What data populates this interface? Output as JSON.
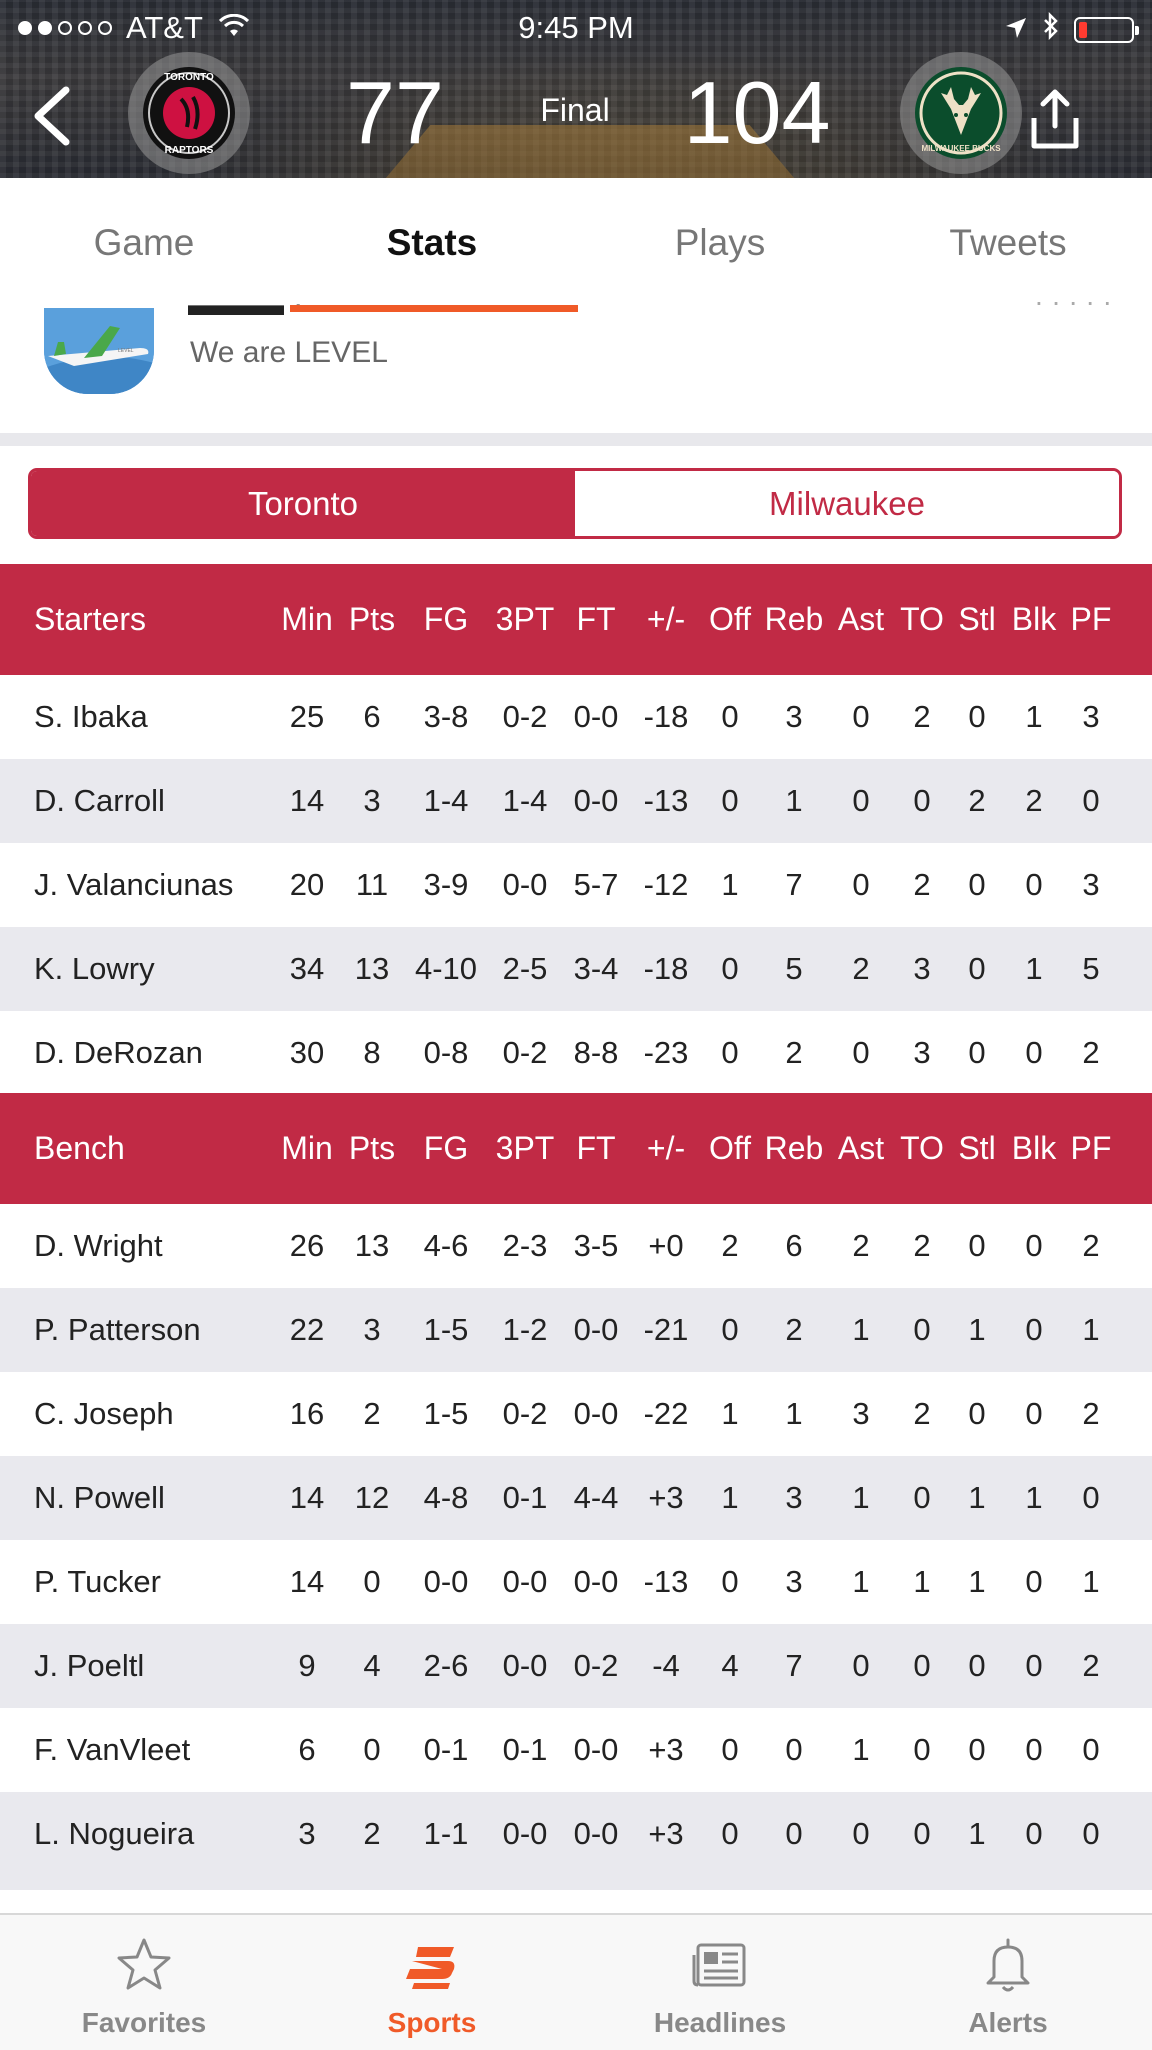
{
  "status_bar": {
    "carrier": "AT&T",
    "time": "9:45 PM",
    "signal_bars_filled": 2,
    "signal_bars_total": 5,
    "battery_level": "low"
  },
  "game_header": {
    "away_team": "Toronto Raptors",
    "away_logo_text": "TORONTO RAPTORS",
    "away_score": "77",
    "status": "Final",
    "home_team": "Milwaukee Bucks",
    "home_logo_text": "MILWAUKEE BUCKS",
    "home_score": "104"
  },
  "tabs": [
    {
      "label": "Game",
      "active": false
    },
    {
      "label": "Stats",
      "active": true
    },
    {
      "label": "Plays",
      "active": false
    },
    {
      "label": "Tweets",
      "active": false
    }
  ],
  "ad": {
    "text": "We are LEVEL",
    "image_caption": "LEVEL"
  },
  "team_selector": {
    "options": [
      "Toronto",
      "Milwaukee"
    ],
    "selected": "Toronto"
  },
  "columns": [
    "Min",
    "Pts",
    "FG",
    "3PT",
    "FT",
    "+/-",
    "Off",
    "Reb",
    "Ast",
    "TO",
    "Stl",
    "Blk",
    "PF"
  ],
  "starters": {
    "title": "Starters",
    "rows": [
      {
        "name": "S. Ibaka",
        "stats": [
          "25",
          "6",
          "3-8",
          "0-2",
          "0-0",
          "-18",
          "0",
          "3",
          "0",
          "2",
          "0",
          "1",
          "3"
        ]
      },
      {
        "name": "D. Carroll",
        "stats": [
          "14",
          "3",
          "1-4",
          "1-4",
          "0-0",
          "-13",
          "0",
          "1",
          "0",
          "0",
          "2",
          "2",
          "0"
        ]
      },
      {
        "name": "J. Valanciunas",
        "stats": [
          "20",
          "11",
          "3-9",
          "0-0",
          "5-7",
          "-12",
          "1",
          "7",
          "0",
          "2",
          "0",
          "0",
          "3"
        ]
      },
      {
        "name": "K. Lowry",
        "stats": [
          "34",
          "13",
          "4-10",
          "2-5",
          "3-4",
          "-18",
          "0",
          "5",
          "2",
          "3",
          "0",
          "1",
          "5"
        ]
      },
      {
        "name": "D. DeRozan",
        "stats": [
          "30",
          "8",
          "0-8",
          "0-2",
          "8-8",
          "-23",
          "0",
          "2",
          "0",
          "3",
          "0",
          "0",
          "2"
        ]
      }
    ]
  },
  "bench": {
    "title": "Bench",
    "rows": [
      {
        "name": "D. Wright",
        "stats": [
          "26",
          "13",
          "4-6",
          "2-3",
          "3-5",
          "+0",
          "2",
          "6",
          "2",
          "2",
          "0",
          "0",
          "2"
        ]
      },
      {
        "name": "P. Patterson",
        "stats": [
          "22",
          "3",
          "1-5",
          "1-2",
          "0-0",
          "-21",
          "0",
          "2",
          "1",
          "0",
          "1",
          "0",
          "1"
        ]
      },
      {
        "name": "C. Joseph",
        "stats": [
          "16",
          "2",
          "1-5",
          "0-2",
          "0-0",
          "-22",
          "1",
          "1",
          "3",
          "2",
          "0",
          "0",
          "2"
        ]
      },
      {
        "name": "N. Powell",
        "stats": [
          "14",
          "12",
          "4-8",
          "0-1",
          "4-4",
          "+3",
          "1",
          "3",
          "1",
          "0",
          "1",
          "1",
          "0"
        ]
      },
      {
        "name": "P. Tucker",
        "stats": [
          "14",
          "0",
          "0-0",
          "0-0",
          "0-0",
          "-13",
          "0",
          "3",
          "1",
          "1",
          "1",
          "0",
          "1"
        ]
      },
      {
        "name": "J. Poeltl",
        "stats": [
          "9",
          "4",
          "2-6",
          "0-0",
          "0-2",
          "-4",
          "4",
          "7",
          "0",
          "0",
          "0",
          "0",
          "2"
        ]
      },
      {
        "name": "F. VanVleet",
        "stats": [
          "6",
          "0",
          "0-1",
          "0-1",
          "0-0",
          "+3",
          "0",
          "0",
          "1",
          "0",
          "0",
          "0",
          "0"
        ]
      },
      {
        "name": "L. Nogueira",
        "stats": [
          "3",
          "2",
          "1-1",
          "0-0",
          "0-0",
          "+3",
          "0",
          "0",
          "0",
          "0",
          "1",
          "0",
          "0"
        ]
      }
    ]
  },
  "bottom_nav": [
    {
      "label": "Favorites",
      "icon": "star-icon",
      "active": false
    },
    {
      "label": "Sports",
      "icon": "sports-logo-icon",
      "active": true
    },
    {
      "label": "Headlines",
      "icon": "newspaper-icon",
      "active": false
    },
    {
      "label": "Alerts",
      "icon": "bell-icon",
      "active": false
    }
  ],
  "colors": {
    "accent_red": "#c12a45",
    "tab_indicator_orange": "#f05a28",
    "alt_row_gray": "#e9e9ee"
  }
}
